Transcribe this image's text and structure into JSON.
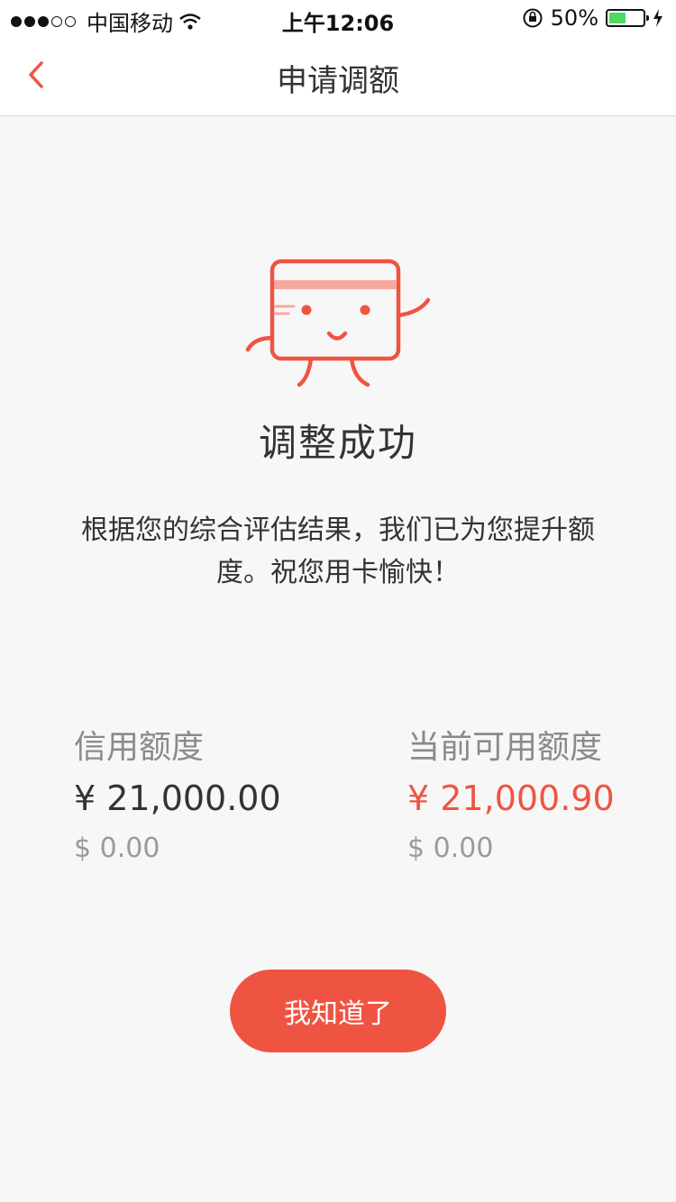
{
  "status_bar": {
    "carrier": "中国移动",
    "time": "上午12:06",
    "battery": "50%",
    "battery_level": 0.5
  },
  "nav": {
    "title": "申请调额",
    "back_icon": "chevron-left-icon"
  },
  "result": {
    "title": "调整成功",
    "description": "根据您的综合评估结果，我们已为您提升额度。祝您用卡愉快！"
  },
  "credit": {
    "label": "信用额度",
    "cny": "¥ 21,000.00",
    "usd": "$ 0.00"
  },
  "available": {
    "label": "当前可用额度",
    "cny": "¥ 21,000.90",
    "usd": "$ 0.00"
  },
  "button": {
    "label": "我知道了"
  },
  "colors": {
    "accent": "#ef5442",
    "background": "#f7f7f7"
  }
}
